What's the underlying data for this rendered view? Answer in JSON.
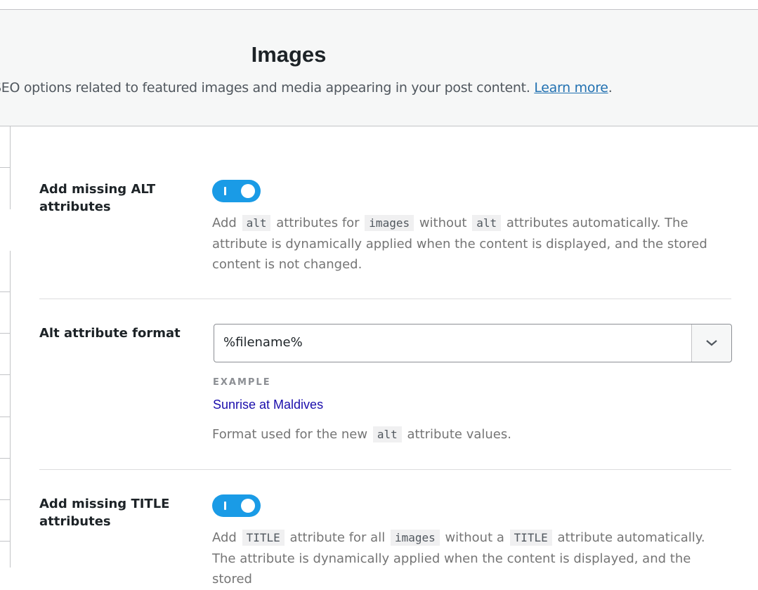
{
  "header": {
    "title": "Images",
    "description": "SEO options related to featured images and media appearing in your post content. ",
    "learn_more": "Learn more",
    "period": "."
  },
  "settings": {
    "alt_missing": {
      "label": "Add missing ALT attributes",
      "enabled": true,
      "help": {
        "t1": "Add ",
        "c1": "alt",
        "t2": " attributes for ",
        "c2": "images",
        "t3": " without ",
        "c3": "alt",
        "t4": " attributes automatically. The attribute is dynamically applied when the content is displayed, and the stored content is not changed."
      }
    },
    "alt_format": {
      "label": "Alt attribute format",
      "value": "%filename%",
      "example_label": "EXAMPLE",
      "example_value": "Sunrise at Maldives",
      "help": {
        "t1": "Format used for the new ",
        "c1": "alt",
        "t2": " attribute values."
      }
    },
    "title_missing": {
      "label": "Add missing TITLE attributes",
      "enabled": true,
      "help": {
        "t1": "Add ",
        "c1": "TITLE",
        "t2": " attribute for all ",
        "c2": "images",
        "t3": " without a ",
        "c3": "TITLE",
        "t4": " attribute automatically. The attribute is dynamically applied when the content is displayed, and the stored"
      }
    }
  },
  "colors": {
    "toggle_on": "#1a9be6",
    "link": "#2271b1",
    "example": "#1a0dab"
  }
}
